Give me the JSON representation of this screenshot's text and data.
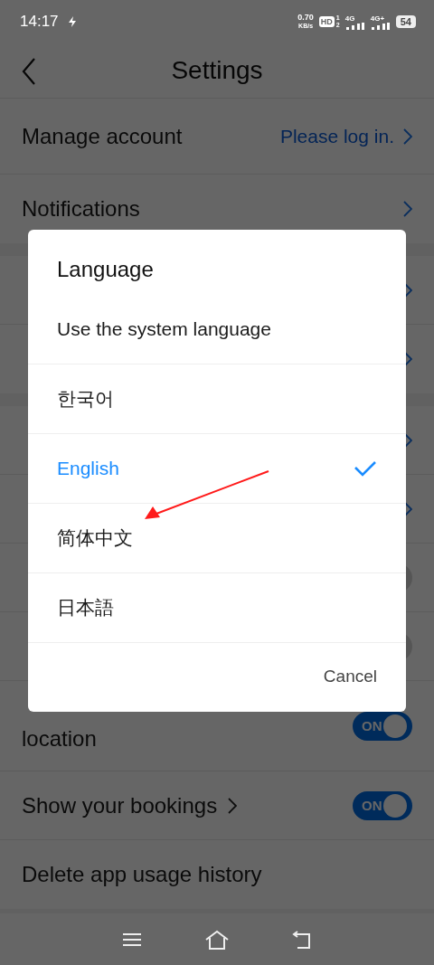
{
  "status_bar": {
    "time": "14:17",
    "net_speed": "0.70",
    "net_unit": "KB/s",
    "hd": "HD",
    "sim_slots": [
      "1",
      "2"
    ],
    "networks": [
      "4G",
      "4G+"
    ],
    "battery": "54"
  },
  "header": {
    "title": "Settings"
  },
  "sections": [
    {
      "rows": [
        {
          "kind": "link",
          "label": "Manage account",
          "value": "Please log in."
        },
        {
          "kind": "link",
          "label": "Notifications"
        }
      ]
    },
    {
      "rows": [
        {
          "kind": "link"
        },
        {
          "kind": "link"
        }
      ]
    },
    {
      "rows": [
        {
          "kind": "link"
        },
        {
          "kind": "link"
        },
        {
          "kind": "toggle",
          "on": false
        },
        {
          "kind": "toggle",
          "on": false
        },
        {
          "kind": "toggle",
          "second_line": "location",
          "on": true,
          "toggle_text": "ON"
        },
        {
          "kind": "toggle",
          "label": "Show your bookings",
          "inline_chevron": true,
          "on": true,
          "toggle_text": "ON"
        },
        {
          "kind": "plain",
          "label": "Delete app usage history"
        }
      ]
    }
  ],
  "dialog": {
    "title": "Language",
    "options": [
      {
        "label": "Use the system language",
        "selected": false
      },
      {
        "label": "한국어",
        "selected": false
      },
      {
        "label": "English",
        "selected": true
      },
      {
        "label": "简体中文",
        "selected": false
      },
      {
        "label": "日本語",
        "selected": false
      }
    ],
    "cancel": "Cancel"
  },
  "annotation_arrow": true
}
